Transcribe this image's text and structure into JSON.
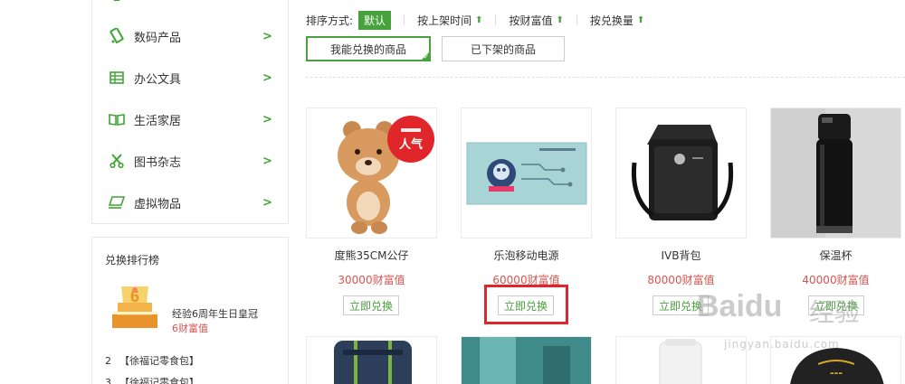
{
  "sidebar": {
    "categories": [
      {
        "label": "数码产品",
        "icon": "phone-icon"
      },
      {
        "label": "办公文具",
        "icon": "spreadsheet-icon"
      },
      {
        "label": "生活家居",
        "icon": "book-icon"
      },
      {
        "label": "图书杂志",
        "icon": "scissors-icon"
      },
      {
        "label": "虚拟物品",
        "icon": "laptop-icon"
      }
    ],
    "chevron": ">",
    "ranking": {
      "title": "兑换排行榜",
      "first": {
        "name": "经验6周年生日皇冠",
        "price": "6财富值",
        "cake_number": "6"
      },
      "rows": [
        {
          "rank": "2",
          "name": "【徐福记零食包】"
        },
        {
          "rank": "3",
          "name": "【徐福记零食包】"
        }
      ]
    }
  },
  "sort": {
    "label": "排序方式:",
    "default": "默认",
    "options": [
      {
        "label": "按上架时间",
        "arrow": "⬆"
      },
      {
        "label": "按财富值",
        "arrow": "⬆"
      },
      {
        "label": "按兑换量",
        "arrow": "⬆"
      }
    ]
  },
  "tabs": {
    "active": "我能兑换的商品",
    "inactive": "已下架的商品",
    "check": "✓"
  },
  "products": [
    {
      "name": "度熊35CM公仔",
      "price": "30000财富值",
      "button": "立即兑换",
      "badge": "人气"
    },
    {
      "name": "乐泡移动电源",
      "price": "60000财富值",
      "button": "立即兑换"
    },
    {
      "name": "IVB背包",
      "price": "80000财富值",
      "button": "立即兑换"
    },
    {
      "name": "保温杯",
      "price": "40000财富值",
      "button": "立即兑换"
    }
  ],
  "watermark": {
    "brand": "Baidu",
    "cn": "经验",
    "url": "jingyan.baidu.com"
  },
  "colors": {
    "accent": "#47a23b",
    "price": "#d9534f",
    "highlight": "#e0262a"
  }
}
